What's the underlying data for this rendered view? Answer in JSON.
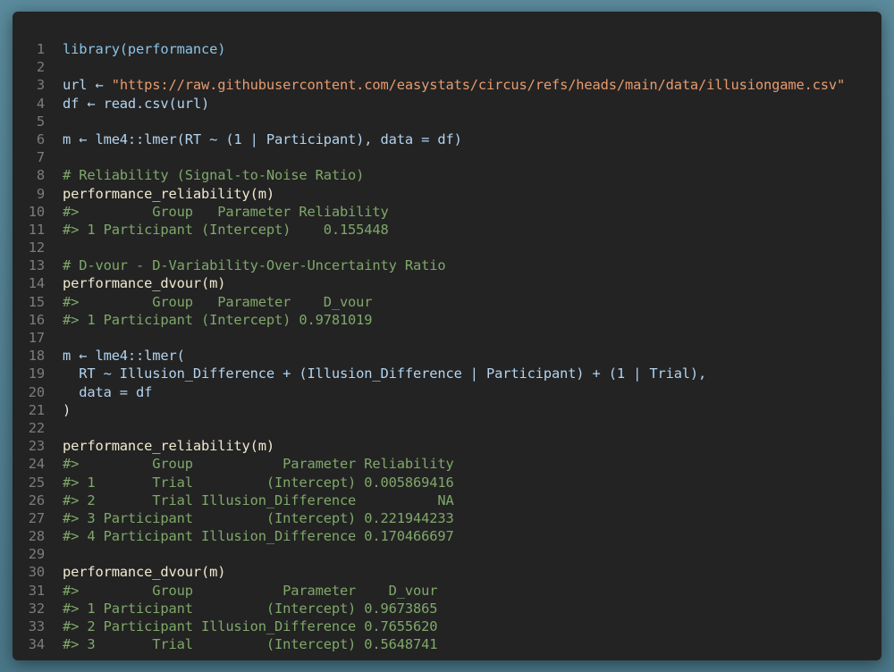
{
  "lines": [
    {
      "n": "1",
      "t": "library(performance)",
      "k": "kw"
    },
    {
      "n": "2",
      "t": "",
      "k": "txt"
    },
    {
      "n": "3",
      "pre": "url ← ",
      "str": "\"https://raw.githubusercontent.com/easystats/circus/refs/heads/main/data/illusiongame.csv\""
    },
    {
      "n": "4",
      "t": "df ← read.csv(url)",
      "k": "vr"
    },
    {
      "n": "5",
      "t": "",
      "k": "txt"
    },
    {
      "n": "6",
      "t": "m ← lme4::lmer(RT ~ (1 | Participant), data = df)",
      "k": "vr"
    },
    {
      "n": "7",
      "t": "",
      "k": "txt"
    },
    {
      "n": "8",
      "t": "# Reliability (Signal-to-Noise Ratio)",
      "k": "cm"
    },
    {
      "n": "9",
      "t": "performance_reliability(m)",
      "k": "fn"
    },
    {
      "n": "10",
      "t": "#>         Group   Parameter Reliability",
      "k": "cm"
    },
    {
      "n": "11",
      "t": "#> 1 Participant (Intercept)    0.155448",
      "k": "cm"
    },
    {
      "n": "12",
      "t": "",
      "k": "txt"
    },
    {
      "n": "13",
      "t": "# D-vour - D-Variability-Over-Uncertainty Ratio",
      "k": "cm"
    },
    {
      "n": "14",
      "t": "performance_dvour(m)",
      "k": "fn"
    },
    {
      "n": "15",
      "t": "#>         Group   Parameter    D_vour",
      "k": "cm"
    },
    {
      "n": "16",
      "t": "#> 1 Participant (Intercept) 0.9781019",
      "k": "cm"
    },
    {
      "n": "17",
      "t": "",
      "k": "txt"
    },
    {
      "n": "18",
      "t": "m ← lme4::lmer(",
      "k": "vr"
    },
    {
      "n": "19",
      "t": "  RT ~ Illusion_Difference + (Illusion_Difference | Participant) + (1 | Trial),",
      "k": "vr"
    },
    {
      "n": "20",
      "t": "  data = df",
      "k": "vr"
    },
    {
      "n": "21",
      "t": ")",
      "k": "txt"
    },
    {
      "n": "22",
      "t": "",
      "k": "txt"
    },
    {
      "n": "23",
      "t": "performance_reliability(m)",
      "k": "fn"
    },
    {
      "n": "24",
      "t": "#>         Group           Parameter Reliability",
      "k": "cm"
    },
    {
      "n": "25",
      "t": "#> 1       Trial         (Intercept) 0.005869416",
      "k": "cm"
    },
    {
      "n": "26",
      "t": "#> 2       Trial Illusion_Difference          NA",
      "k": "cm"
    },
    {
      "n": "27",
      "t": "#> 3 Participant         (Intercept) 0.221944233",
      "k": "cm"
    },
    {
      "n": "28",
      "t": "#> 4 Participant Illusion_Difference 0.170466697",
      "k": "cm"
    },
    {
      "n": "29",
      "t": "",
      "k": "txt"
    },
    {
      "n": "30",
      "t": "performance_dvour(m)",
      "k": "fn"
    },
    {
      "n": "31",
      "t": "#>         Group           Parameter    D_vour",
      "k": "cm"
    },
    {
      "n": "32",
      "t": "#> 1 Participant         (Intercept) 0.9673865",
      "k": "cm"
    },
    {
      "n": "33",
      "t": "#> 2 Participant Illusion_Difference 0.7655620",
      "k": "cm"
    },
    {
      "n": "34",
      "t": "#> 3       Trial         (Intercept) 0.5648741",
      "k": "cm"
    }
  ]
}
